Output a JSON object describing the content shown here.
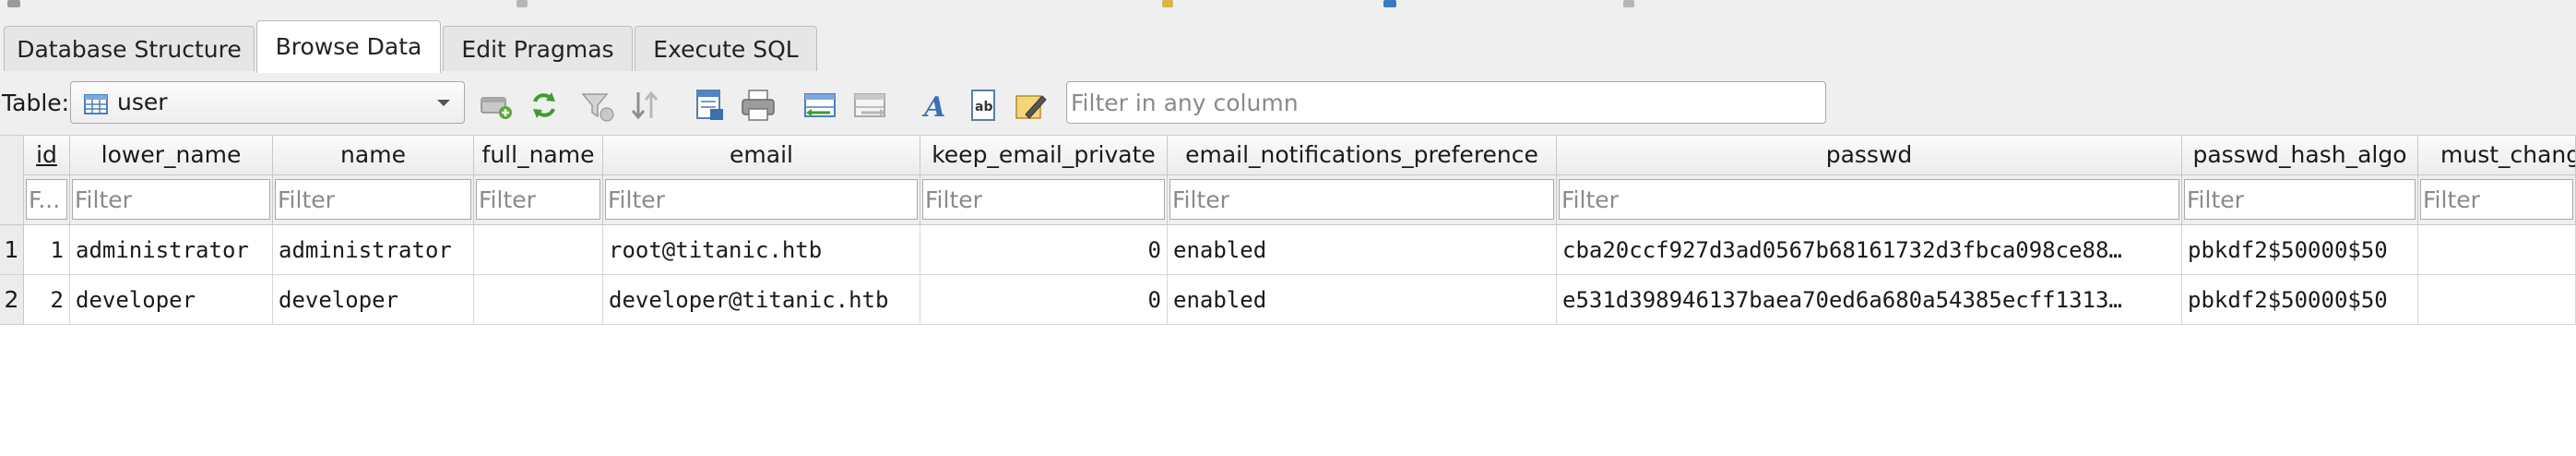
{
  "window": {
    "accent_color": "#2f74c0"
  },
  "tabs": [
    {
      "label": "Database Structure",
      "active": false
    },
    {
      "label": "Browse Data",
      "active": true
    },
    {
      "label": "Edit Pragmas",
      "active": false
    },
    {
      "label": "Execute SQL",
      "active": false
    }
  ],
  "toolbar": {
    "table_label": "Table:",
    "table_value": "user",
    "filter_placeholder": "Filter in any column",
    "tools": [
      "refresh-table-icon",
      "clear-filters-icon",
      "sort-icon",
      "save-table-icon",
      "print-icon",
      "insert-record-icon",
      "delete-record-icon",
      "font-icon",
      "text-format-icon",
      "edit-cell-icon"
    ]
  },
  "grid": {
    "filter_placeholder": "Filter",
    "first_filter_placeholder": "F...",
    "columns": [
      {
        "name": "id",
        "sorted": true
      },
      {
        "name": "lower_name",
        "sorted": false
      },
      {
        "name": "name",
        "sorted": false
      },
      {
        "name": "full_name",
        "sorted": false
      },
      {
        "name": "email",
        "sorted": false
      },
      {
        "name": "keep_email_private",
        "sorted": false
      },
      {
        "name": "email_notifications_preference",
        "sorted": false
      },
      {
        "name": "passwd",
        "sorted": false
      },
      {
        "name": "passwd_hash_algo",
        "sorted": false
      },
      {
        "name": "must_change",
        "sorted": false
      }
    ],
    "rows": [
      {
        "row_number": "1",
        "cells": [
          "1",
          "administrator",
          "administrator",
          "",
          "root@titanic.htb",
          "0",
          "enabled",
          "cba20ccf927d3ad0567b68161732d3fbca098ce88…",
          "pbkdf2$50000$50",
          ""
        ]
      },
      {
        "row_number": "2",
        "cells": [
          "2",
          "developer",
          "developer",
          "",
          "developer@titanic.htb",
          "0",
          "enabled",
          "e531d398946137baea70ed6a680a54385ecff1313…",
          "pbkdf2$50000$50",
          ""
        ]
      }
    ]
  }
}
